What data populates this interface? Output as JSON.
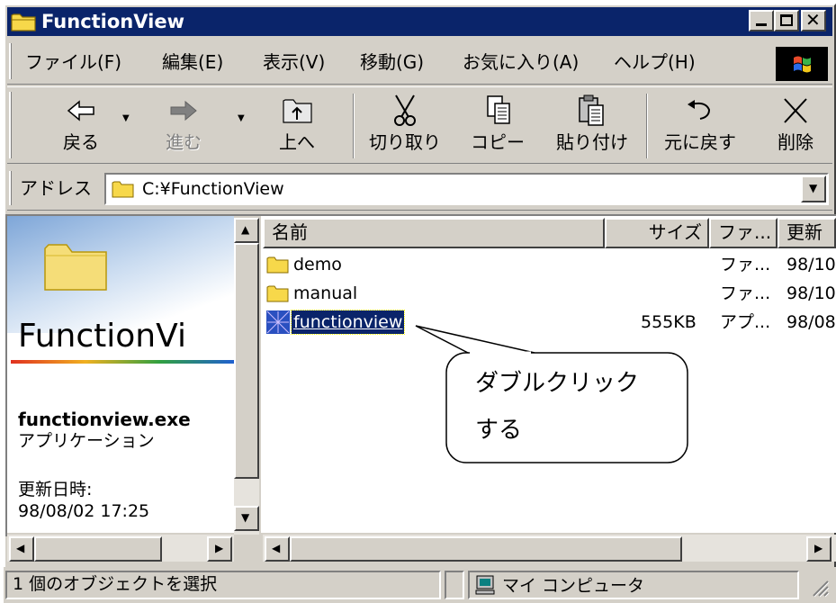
{
  "window": {
    "title": "FunctionView"
  },
  "menu": [
    "ファイル(F)",
    "編集(E)",
    "表示(V)",
    "移動(G)",
    "お気に入り(A)",
    "ヘルプ(H)"
  ],
  "toolbar": {
    "back": "戻る",
    "forward": "進む",
    "up": "上へ",
    "cut": "切り取り",
    "copy": "コピー",
    "paste": "貼り付け",
    "undo": "元に戻す",
    "delete": "削除"
  },
  "address": {
    "label": "アドレス",
    "value": "C:¥FunctionView"
  },
  "left_pane": {
    "folder_title": "FunctionVi",
    "file_name": "functionview.exe",
    "file_type": "アプリケーション",
    "modified_label": "更新日時:",
    "modified_value": "98/08/02 17:25"
  },
  "columns": [
    "名前",
    "サイズ",
    "ファ...",
    "更新"
  ],
  "files": [
    {
      "name": "demo",
      "size": "",
      "type": "ファ...",
      "date": "98/10"
    },
    {
      "name": "manual",
      "size": "",
      "type": "ファ...",
      "date": "98/10"
    },
    {
      "name": "functionview",
      "size": "555KB",
      "type": "アプ...",
      "date": "98/08"
    }
  ],
  "callout": {
    "line1": "ダブルクリック",
    "line2": "する"
  },
  "status": {
    "selection": "1 個のオブジェクトを選択",
    "location": "マイ コンピュータ"
  },
  "colors": {
    "titlebar": "#0a246a",
    "selection": "#0a246a",
    "face": "#d4d0c8"
  }
}
